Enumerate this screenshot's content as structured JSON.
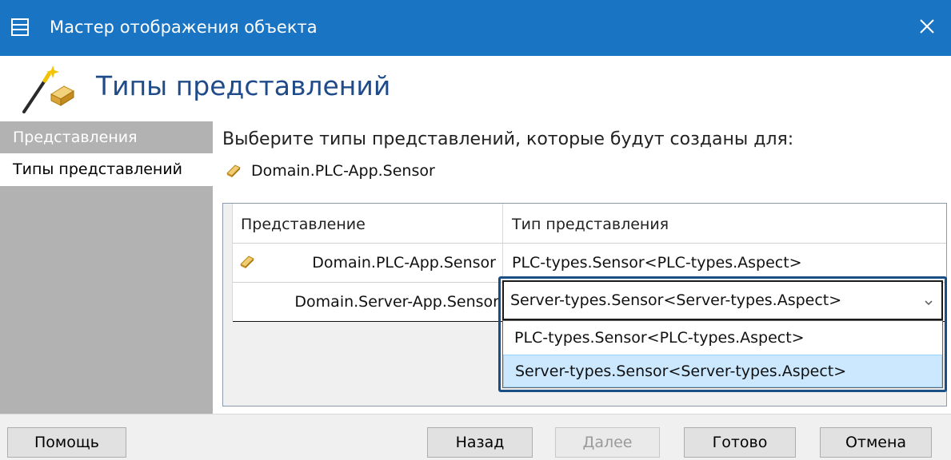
{
  "window": {
    "title": "Мастер отображения объекта",
    "title_bar_color": "#1a74c4",
    "icon": "window-form-icon",
    "close_icon": "close-icon"
  },
  "header": {
    "title": "Типы представлений",
    "icon": "magic-wand-icon",
    "title_color": "#1f4b8a"
  },
  "sidebar": {
    "items": [
      {
        "label": "Представления",
        "selected": false
      },
      {
        "label": "Типы представлений",
        "selected": true
      }
    ]
  },
  "main": {
    "instruction": "Выберите типы представлений, которые будут созданы для:",
    "object_name": "Domain.PLC-App.Sensor",
    "object_icon": "gold-bar-icon",
    "grid": {
      "columns": [
        "Представление",
        "Тип представления"
      ],
      "rows": [
        {
          "view": "Domain.PLC-App.Sensor",
          "type": "PLC-types.Sensor<PLC-types.Aspect>",
          "icon": "gold-bar-icon"
        },
        {
          "view": "Domain.Server-App.Sensor",
          "type": "Server-types.Sensor<Server-types.Aspect>"
        }
      ],
      "dropdown": {
        "selected": "Server-types.Sensor<Server-types.Aspect>",
        "options": [
          "PLC-types.Sensor<PLC-types.Aspect>",
          "Server-types.Sensor<Server-types.Aspect>"
        ],
        "highlighted_index": 1,
        "highlight_color": "#cce8ff",
        "arrow_icon": "chevron-down-icon"
      }
    }
  },
  "footer": {
    "help": "Помощь",
    "back": "Назад",
    "next": "Далее",
    "next_enabled": false,
    "done": "Готово",
    "cancel": "Отмена"
  }
}
